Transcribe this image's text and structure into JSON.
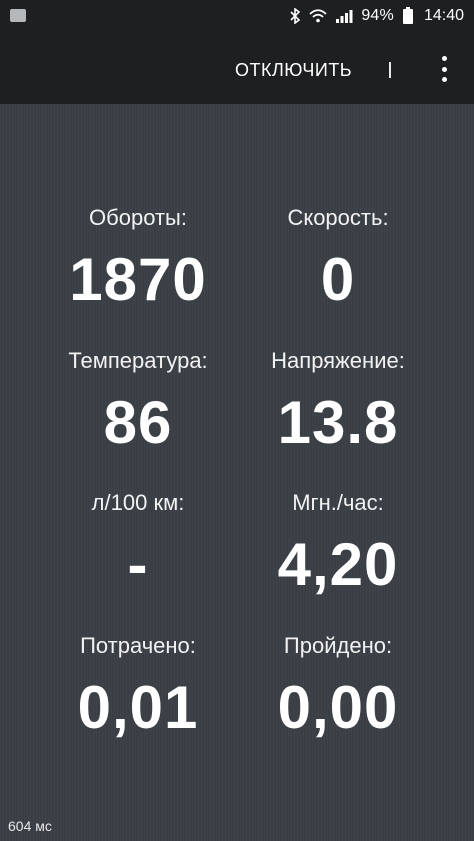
{
  "status_bar": {
    "battery_percent": "94%",
    "time": "14:40"
  },
  "toolbar": {
    "disconnect_label": "ОТКЛЮЧИТЬ",
    "divider_label": "|"
  },
  "metrics": [
    {
      "label": "Обороты:",
      "value": "1870"
    },
    {
      "label": "Скорость:",
      "value": "0"
    },
    {
      "label": "Температура:",
      "value": "86"
    },
    {
      "label": "Напряжение:",
      "value": "13.8"
    },
    {
      "label": "л/100 км:",
      "value": "-"
    },
    {
      "label": "Мгн./час:",
      "value": "4,20"
    },
    {
      "label": "Потрачено:",
      "value": "0,01"
    },
    {
      "label": "Пройдено:",
      "value": "0,00"
    }
  ],
  "footer": {
    "latency": "604 мс"
  },
  "colors": {
    "background": "#3b4047",
    "toolbar": "#1e1f21",
    "text": "#ffffff"
  },
  "icons": [
    "notification-icon",
    "bluetooth-icon",
    "wifi-icon",
    "signal-icon",
    "battery-icon",
    "more-vert-icon"
  ]
}
